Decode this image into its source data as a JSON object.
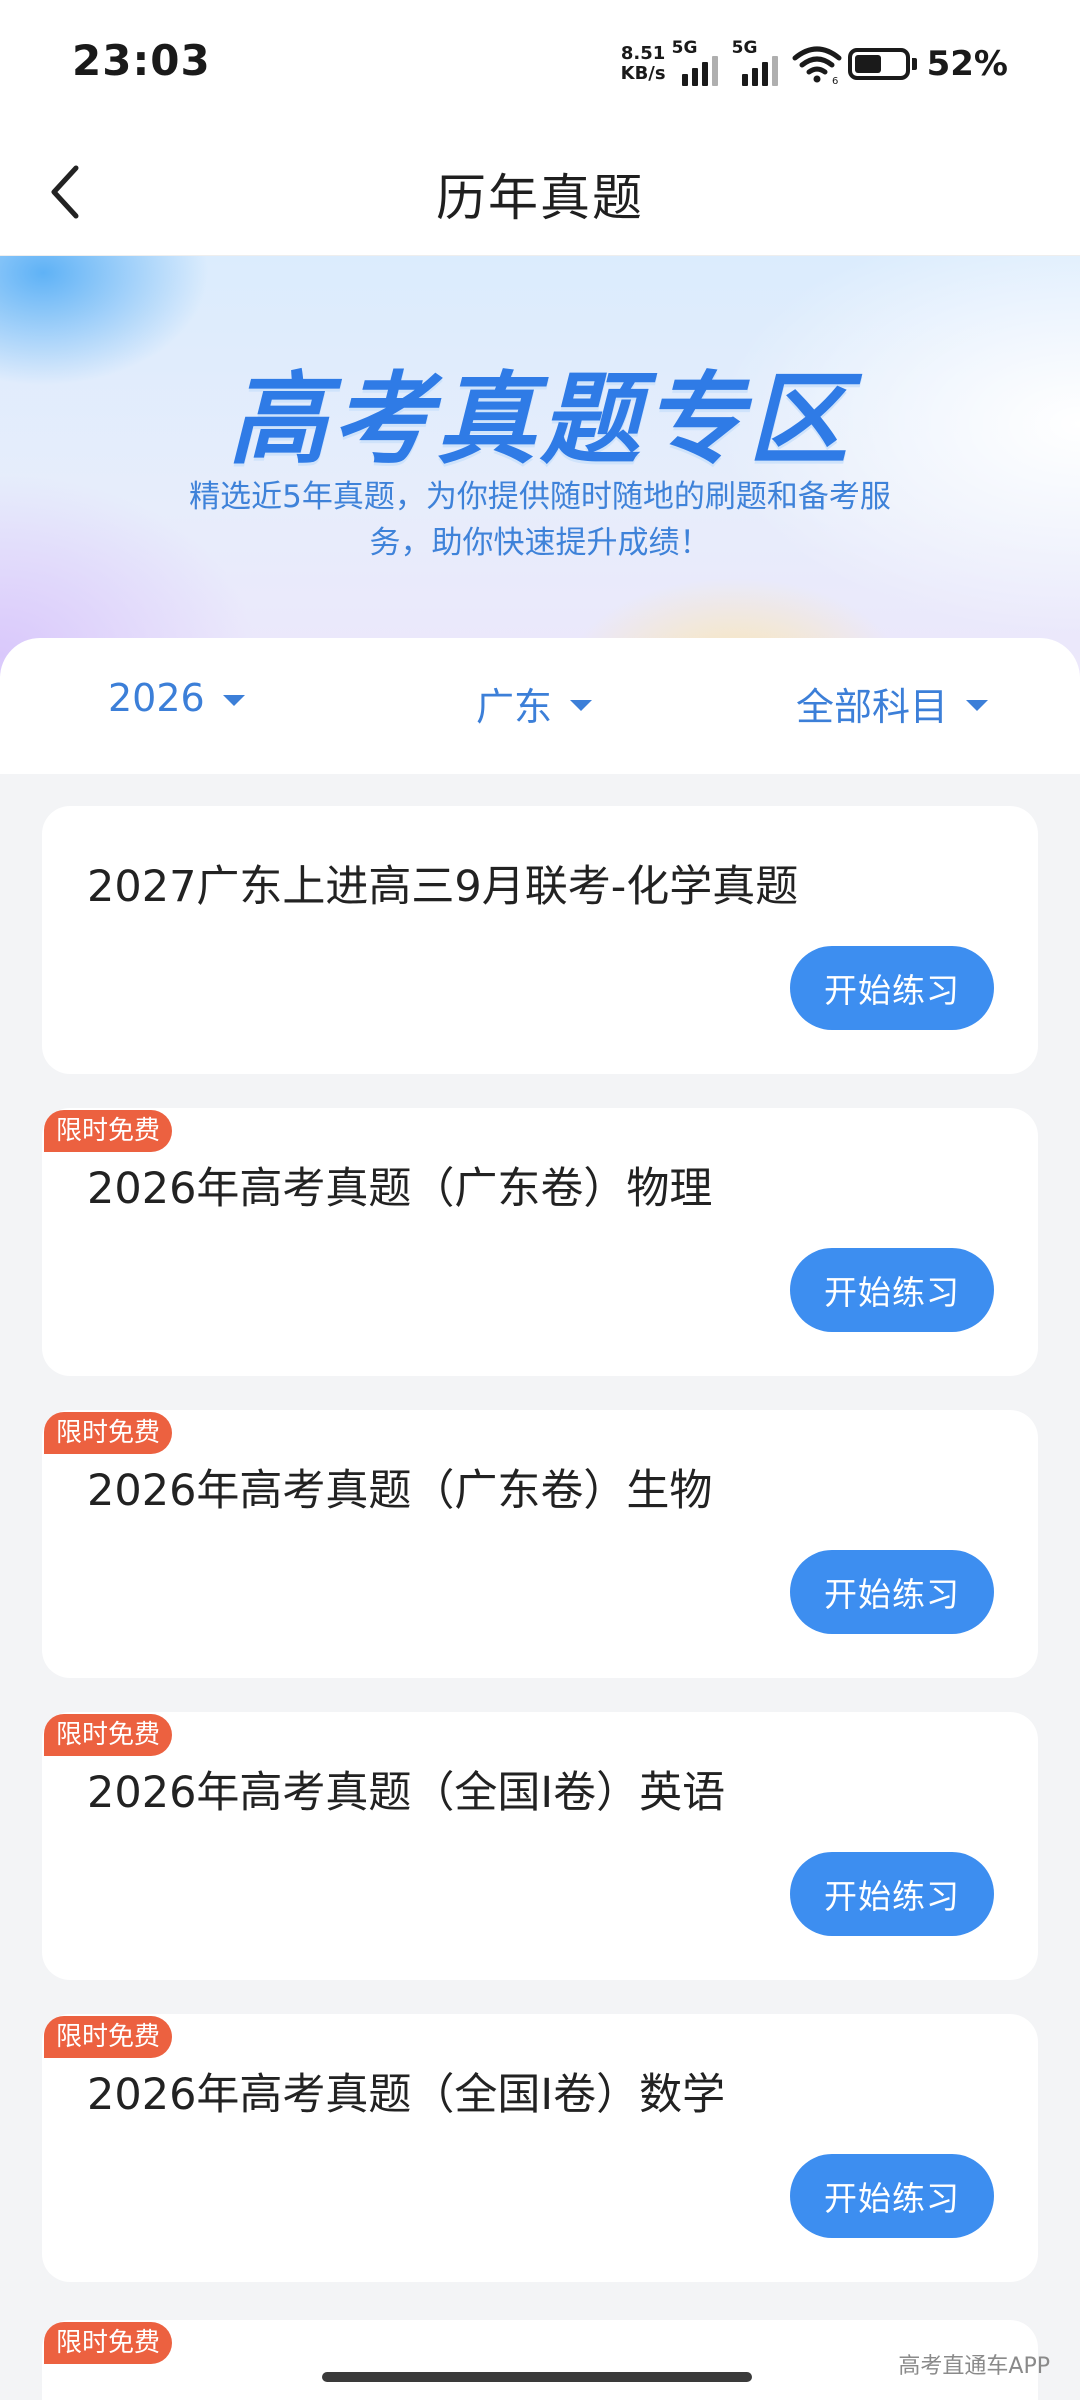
{
  "status_bar": {
    "time": "23:03",
    "net_speed_value": "8.51",
    "net_speed_unit": "KB/s",
    "signal1_tag": "5G",
    "signal2_tag": "5G",
    "battery_pct": "52%",
    "battery_level": 0.52
  },
  "nav": {
    "title": "历年真题"
  },
  "banner": {
    "title": "高考真题专区",
    "subtitle": "精选近5年真题，为你提供随时随地的刷题和备考服务，助你快速提升成绩！"
  },
  "filters": {
    "year": "2026",
    "region": "广东",
    "subject": "全部科目"
  },
  "cards": [
    {
      "title": "2027广东上进高三9月联考-化学真题",
      "badge": "",
      "button": "开始练习"
    },
    {
      "title": "2026年高考真题（广东卷）物理",
      "badge": "限时免费",
      "button": "开始练习"
    },
    {
      "title": "2026年高考真题（广东卷）生物",
      "badge": "限时免费",
      "button": "开始练习"
    },
    {
      "title": "2026年高考真题（全国I卷）英语",
      "badge": "限时免费",
      "button": "开始练习"
    },
    {
      "title": "2026年高考真题（全国I卷）数学",
      "badge": "限时免费",
      "button": "开始练习"
    }
  ],
  "partial_card": {
    "badge": "限时免费"
  },
  "watermark": "高考直通车APP",
  "colors": {
    "accent": "#3d8ef0",
    "badge": "#ec6140",
    "filter_text": "#3c7fd8"
  }
}
